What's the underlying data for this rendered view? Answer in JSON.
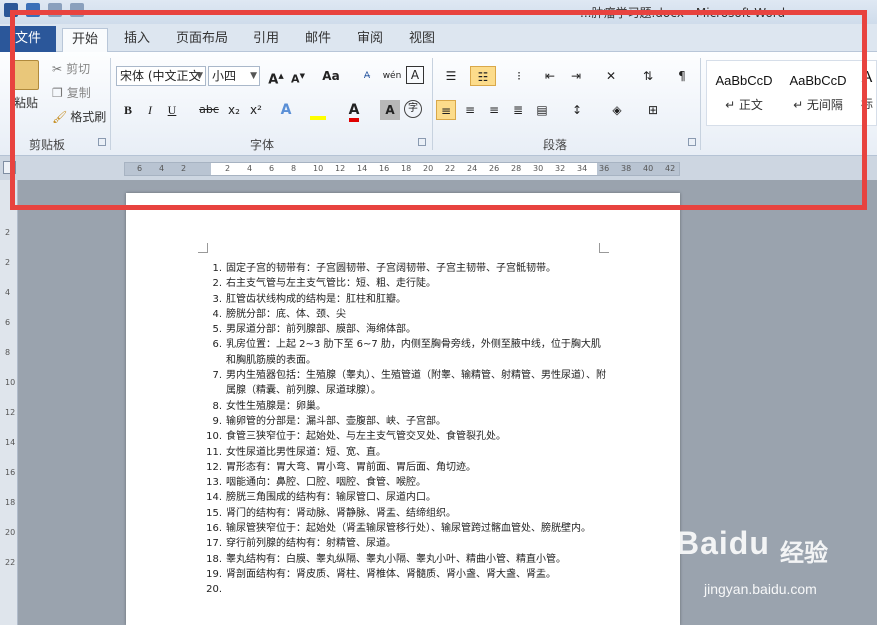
{
  "window": {
    "title": "...肿瘤学习题.docx - Microsoft Word"
  },
  "tabs": {
    "file": "文件",
    "items": [
      "开始",
      "插入",
      "页面布局",
      "引用",
      "邮件",
      "审阅",
      "视图"
    ],
    "active": "开始"
  },
  "clipboard": {
    "paste": "粘贴",
    "cut": "剪切",
    "copy": "复制",
    "format_painter": "格式刷",
    "group_label": "剪贴板"
  },
  "font": {
    "font_name": "宋体 (中文正文",
    "font_size": "小四",
    "group_label": "字体",
    "grow": "A",
    "shrink": "A",
    "change_case": "Aa",
    "bold": "B",
    "italic": "I",
    "underline": "U",
    "strikethrough": "abc",
    "subscript": "x₂",
    "superscript": "x²",
    "text_effect": "A",
    "font_color": "A",
    "char_shading": "A",
    "enclose": "字",
    "phonetic": "wén",
    "highlight_color": "#ffff00",
    "font_color_hex": "#e00000"
  },
  "paragraph": {
    "group_label": "段落"
  },
  "styles": {
    "items": [
      {
        "preview": "AaBbCcD",
        "name": "↵ 正文"
      },
      {
        "preview": "AaBbCcD",
        "name": "↵ 无间隔"
      },
      {
        "preview": "A",
        "name": "标"
      }
    ]
  },
  "ruler": {
    "ticks": [
      "6",
      "4",
      "2",
      "",
      "2",
      "4",
      "6",
      "8",
      "10",
      "12",
      "14",
      "16",
      "18",
      "20",
      "22",
      "24",
      "26",
      "28",
      "30",
      "32",
      "34",
      "36",
      "38",
      "40",
      "42"
    ],
    "vticks": [
      "2",
      "2",
      "4",
      "6",
      "8",
      "10",
      "12",
      "14",
      "16",
      "18",
      "20",
      "22"
    ]
  },
  "document": {
    "items": [
      {
        "n": "1.",
        "t": "固定子宫的韧带有：子宫圆韧带、子宫阔韧带、子宫主韧带、子宫骶韧带。"
      },
      {
        "n": "2.",
        "t": "右主支气管与左主支气管比：短、粗、走行陡。"
      },
      {
        "n": "3.",
        "t": "肛管齿状线构成的结构是：肛柱和肛瓣。"
      },
      {
        "n": "4.",
        "t": "膀胱分部：底、体、颈、尖"
      },
      {
        "n": "5.",
        "t": "男尿道分部：前列腺部、膜部、海绵体部。"
      },
      {
        "n": "6.",
        "t": "乳房位置：上起 2~3 肋下至 6~7 肋，内侧至胸骨旁线，外侧至腋中线，位于胸大肌和胸肌筋膜的表面。"
      },
      {
        "n": "7.",
        "t": "男内生殖器包括：生殖腺（睾丸）、生殖管道（附睾、输精管、射精管、男性尿道）、附属腺（精囊、前列腺、尿道球腺）。"
      },
      {
        "n": "8.",
        "t": "女性生殖腺是：卵巢。"
      },
      {
        "n": "9.",
        "t": "输卵管的分部是：漏斗部、壶腹部、峡、子宫部。"
      },
      {
        "n": "10.",
        "t": "食管三狭窄位于：起始处、与左主支气管交叉处、食管裂孔处。"
      },
      {
        "n": "11.",
        "t": "女性尿道比男性尿道：短、宽、直。"
      },
      {
        "n": "12.",
        "t": "胃形态有：胃大弯、胃小弯、胃前面、胃后面、角切迹。"
      },
      {
        "n": "13.",
        "t": "咽能通向：鼻腔、口腔、咽腔、食管、喉腔。"
      },
      {
        "n": "14.",
        "t": "膀胱三角围成的结构有：输尿管口、尿道内口。"
      },
      {
        "n": "15.",
        "t": "肾门的结构有：肾动脉、肾静脉、肾盂、结缔组织。"
      },
      {
        "n": "16.",
        "t": "输尿管狭窄位于：起始处（肾盂输尿管移行处）、输尿管跨过髂血管处、膀胱壁内。"
      },
      {
        "n": "17.",
        "t": "穿行前列腺的结构有：射精管、尿道。"
      },
      {
        "n": "18.",
        "t": "睾丸结构有：白膜、睾丸纵隔、睾丸小隔、睾丸小叶、精曲小管、精直小管。"
      },
      {
        "n": "19.",
        "t": "肾剖面结构有：肾皮质、肾柱、肾椎体、肾髓质、肾小盏、肾大盏、肾盂。"
      },
      {
        "n": "20.",
        "t": ""
      }
    ]
  },
  "watermark": {
    "logo": "Baidu",
    "cn": "经验",
    "url": "jingyan.baidu.com"
  },
  "colors": {
    "annotation_border": "#e8433f",
    "file_tab": "#2b579a"
  }
}
